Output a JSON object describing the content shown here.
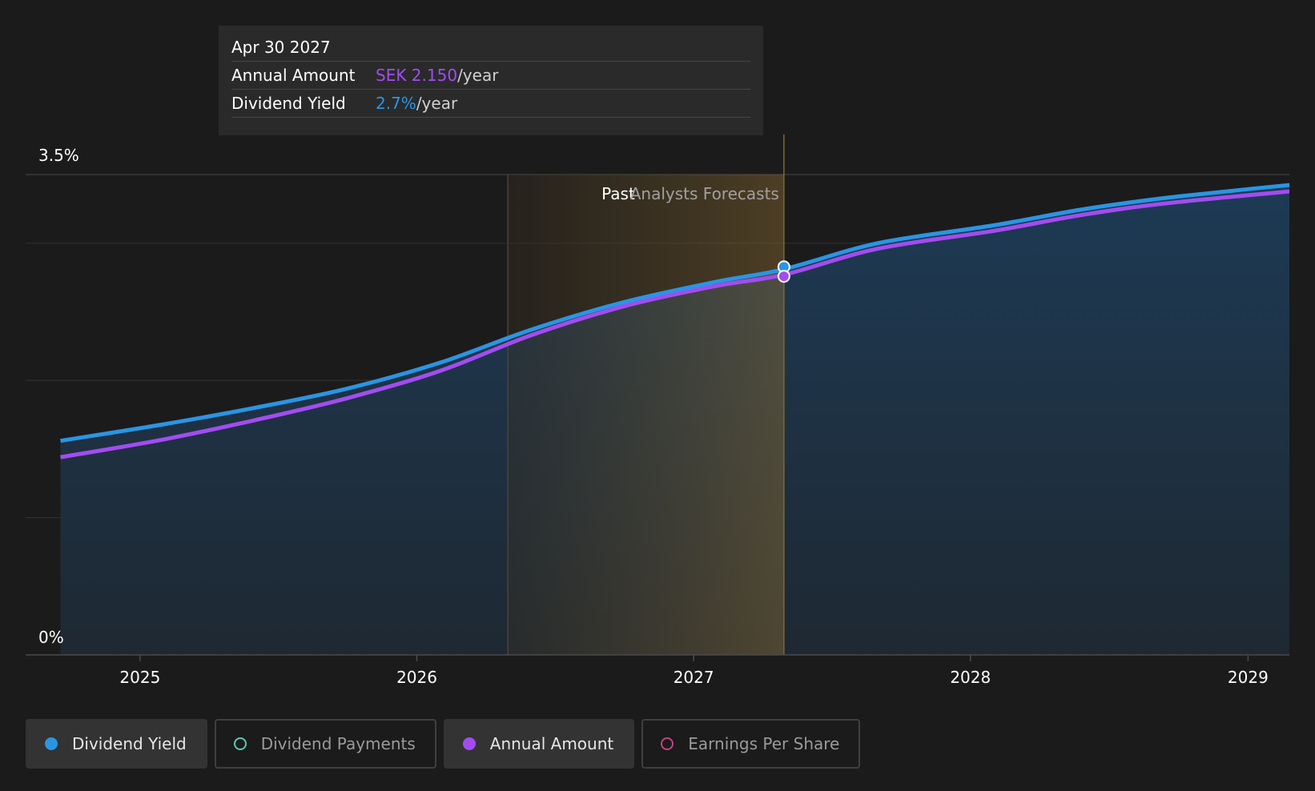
{
  "tooltip": {
    "date": "Apr 30 2027",
    "annual_label": "Annual Amount",
    "annual_value": "SEK 2.150",
    "annual_unit": "/year",
    "yield_label": "Dividend Yield",
    "yield_value": "2.7%",
    "yield_unit": "/year"
  },
  "regions": {
    "past_label": "Past",
    "forecast_label_1": "Analysts",
    "forecast_label_2": "Forecasts"
  },
  "legend": [
    {
      "label": "Dividend Yield",
      "color": "#2a95e4",
      "active": true,
      "marker": "filled"
    },
    {
      "label": "Dividend Payments",
      "color": "#5cc7b6",
      "active": false,
      "marker": "hollow"
    },
    {
      "label": "Annual Amount",
      "color": "#a24cf0",
      "active": true,
      "marker": "filled"
    },
    {
      "label": "Earnings Per Share",
      "color": "#c0457f",
      "active": false,
      "marker": "hollow"
    }
  ],
  "chart_data": {
    "type": "line",
    "x_range": [
      "2024-08-01",
      "2029-05-01"
    ],
    "y_range": [
      0,
      3.5
    ],
    "y_unit": "%",
    "y_tick_labels": [
      "3.5%",
      "0%"
    ],
    "x_tick_labels": [
      "2025",
      "2026",
      "2027",
      "2028",
      "2029"
    ],
    "gridlines": true,
    "past_region": [
      "2026-05-01",
      "2027-04-30"
    ],
    "hover_date": "2027-04-30",
    "series": [
      {
        "name": "Dividend Yield",
        "color": "#2a95e4",
        "points": [
          [
            "2024-09-18",
            1.56
          ],
          [
            "2025-02-01",
            1.68
          ],
          [
            "2025-06-01",
            1.8
          ],
          [
            "2025-10-01",
            1.94
          ],
          [
            "2026-02-01",
            2.13
          ],
          [
            "2026-06-01",
            2.37
          ],
          [
            "2026-10-01",
            2.57
          ],
          [
            "2027-02-01",
            2.72
          ],
          [
            "2027-04-30",
            2.81
          ],
          [
            "2027-09-01",
            3.0
          ],
          [
            "2028-02-01",
            3.13
          ],
          [
            "2028-06-01",
            3.25
          ],
          [
            "2028-10-01",
            3.34
          ],
          [
            "2029-05-01",
            3.46
          ]
        ]
      },
      {
        "name": "Annual Amount",
        "color": "#a24cf0",
        "points": [
          [
            "2024-09-18",
            1.44
          ],
          [
            "2025-02-01",
            1.57
          ],
          [
            "2025-06-01",
            1.71
          ],
          [
            "2025-10-01",
            1.87
          ],
          [
            "2026-02-01",
            2.07
          ],
          [
            "2026-06-01",
            2.33
          ],
          [
            "2026-10-01",
            2.54
          ],
          [
            "2027-02-01",
            2.69
          ],
          [
            "2027-04-30",
            2.77
          ],
          [
            "2027-09-01",
            2.96
          ],
          [
            "2028-02-01",
            3.09
          ],
          [
            "2028-06-01",
            3.21
          ],
          [
            "2028-10-01",
            3.3
          ],
          [
            "2029-05-01",
            3.41
          ]
        ]
      }
    ]
  }
}
